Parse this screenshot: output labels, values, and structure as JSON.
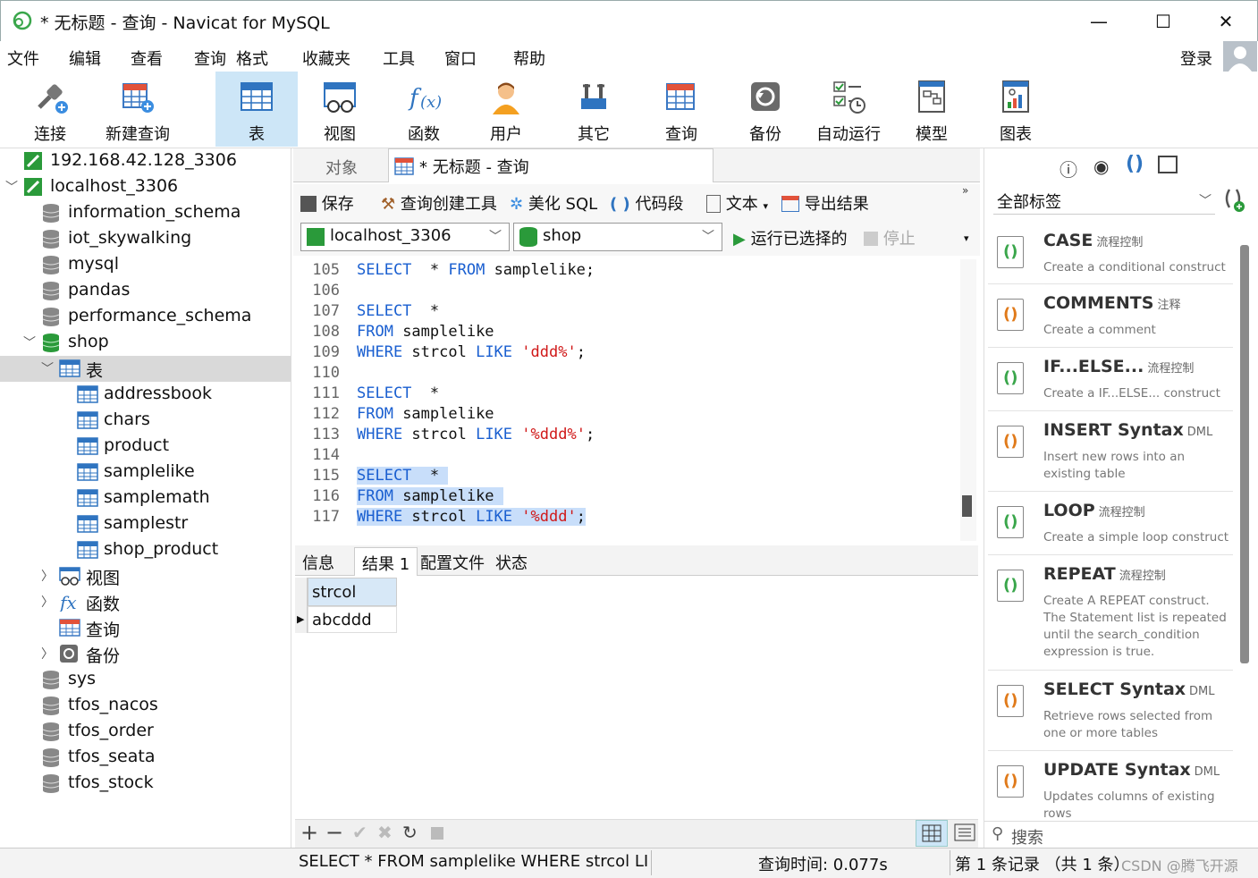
{
  "window": {
    "title": "* 无标题 - 查询 - Navicat for MySQL",
    "minimize": "—",
    "maximize": "☐",
    "close": "✕"
  },
  "menu": [
    "文件",
    "编辑",
    "查看",
    "查询",
    "格式",
    "收藏夹",
    "工具",
    "窗口",
    "帮助"
  ],
  "login": "登录",
  "toolbar": [
    {
      "label": "连接",
      "icon": "plug-icon"
    },
    {
      "label": "新建查询",
      "icon": "new-query-icon"
    },
    {
      "label": "表",
      "icon": "table-icon"
    },
    {
      "label": "视图",
      "icon": "view-icon"
    },
    {
      "label": "函数",
      "icon": "function-icon"
    },
    {
      "label": "用户",
      "icon": "user-icon"
    },
    {
      "label": "其它",
      "icon": "tools-icon"
    },
    {
      "label": "查询",
      "icon": "query-icon"
    },
    {
      "label": "备份",
      "icon": "backup-icon"
    },
    {
      "label": "自动运行",
      "icon": "schedule-icon"
    },
    {
      "label": "模型",
      "icon": "model-icon"
    },
    {
      "label": "图表",
      "icon": "chart-icon"
    }
  ],
  "tree": [
    {
      "label": "192.168.42.128_3306"
    },
    {
      "label": "localhost_3306"
    },
    {
      "label": "information_schema"
    },
    {
      "label": "iot_skywalking"
    },
    {
      "label": "mysql"
    },
    {
      "label": "pandas"
    },
    {
      "label": "performance_schema"
    },
    {
      "label": "shop"
    },
    {
      "label": "表"
    },
    {
      "label": "addressbook"
    },
    {
      "label": "chars"
    },
    {
      "label": "product"
    },
    {
      "label": "samplelike"
    },
    {
      "label": "samplemath"
    },
    {
      "label": "samplestr"
    },
    {
      "label": "shop_product"
    },
    {
      "label": "视图"
    },
    {
      "label": "函数"
    },
    {
      "label": "查询"
    },
    {
      "label": "备份"
    },
    {
      "label": "sys"
    },
    {
      "label": "tfos_nacos"
    },
    {
      "label": "tfos_order"
    },
    {
      "label": "tfos_seata"
    },
    {
      "label": "tfos_stock"
    }
  ],
  "tabs": {
    "objects": "对象",
    "query": "* 无标题 - 查询"
  },
  "editor_toolbar": {
    "save": "保存",
    "builder": "查询创建工具",
    "beautify": "美化 SQL",
    "snippet": "代码段",
    "text": "文本",
    "export": "导出结果"
  },
  "selectors": {
    "connection": "localhost_3306",
    "database": "shop",
    "run": "运行已选择的",
    "stop": "停止"
  },
  "code_lines": [
    {
      "n": "105",
      "t": [
        [
          "kw",
          "SELECT"
        ],
        [
          "",
          "  * "
        ],
        [
          "kw",
          "FROM"
        ],
        [
          "",
          " samplelike;"
        ]
      ]
    },
    {
      "n": "106",
      "t": []
    },
    {
      "n": "107",
      "t": [
        [
          "kw",
          "SELECT"
        ],
        [
          "",
          "  *"
        ]
      ]
    },
    {
      "n": "108",
      "t": [
        [
          "kw",
          "FROM"
        ],
        [
          "",
          " samplelike"
        ]
      ]
    },
    {
      "n": "109",
      "t": [
        [
          "kw",
          "WHERE"
        ],
        [
          "",
          " strcol "
        ],
        [
          "kw",
          "LIKE"
        ],
        [
          "",
          " "
        ],
        [
          "str",
          "'ddd%'"
        ],
        [
          "",
          ";"
        ]
      ]
    },
    {
      "n": "110",
      "t": []
    },
    {
      "n": "111",
      "t": [
        [
          "kw",
          "SELECT"
        ],
        [
          "",
          "  *"
        ]
      ]
    },
    {
      "n": "112",
      "t": [
        [
          "kw",
          "FROM"
        ],
        [
          "",
          " samplelike"
        ]
      ]
    },
    {
      "n": "113",
      "t": [
        [
          "kw",
          "WHERE"
        ],
        [
          "",
          " strcol "
        ],
        [
          "kw",
          "LIKE"
        ],
        [
          "",
          " "
        ],
        [
          "str",
          "'%ddd%'"
        ],
        [
          "",
          ";"
        ]
      ]
    },
    {
      "n": "114",
      "t": []
    },
    {
      "n": "115",
      "t": [
        [
          "kw",
          "SELECT"
        ],
        [
          "",
          "  * "
        ]
      ],
      "hl": true
    },
    {
      "n": "116",
      "t": [
        [
          "kw",
          "FROM"
        ],
        [
          "",
          " samplelike "
        ]
      ],
      "hl": true
    },
    {
      "n": "117",
      "t": [
        [
          "kw",
          "WHERE"
        ],
        [
          "",
          " strcol "
        ],
        [
          "kw",
          "LIKE"
        ],
        [
          "",
          " "
        ],
        [
          "str",
          "'%ddd'"
        ],
        [
          "",
          ";"
        ]
      ],
      "hl": true
    }
  ],
  "result_tabs": [
    "信息",
    "结果 1",
    "配置文件",
    "状态"
  ],
  "result": {
    "column": "strcol",
    "rows": [
      "abcddd"
    ]
  },
  "status": {
    "sql": "SELECT * FROM samplelike WHERE strcol LIKE",
    "time": "查询时间: 0.077s",
    "records": "第 1 条记录 （共 1 条）",
    "watermark": "CSDN @腾飞开源"
  },
  "right_panel": {
    "filter": "全部标签",
    "search": "搜索",
    "snippets": [
      {
        "name": "CASE",
        "cat": "流程控制",
        "desc": "Create a conditional construct"
      },
      {
        "name": "COMMENTS",
        "cat": "注释",
        "desc": "Create a comment"
      },
      {
        "name": "IF...ELSE...",
        "cat": "流程控制",
        "desc": "Create a IF...ELSE... construct"
      },
      {
        "name": "INSERT Syntax",
        "cat": "DML",
        "desc": "Insert new rows into an existing table"
      },
      {
        "name": "LOOP",
        "cat": "流程控制",
        "desc": "Create a simple loop construct"
      },
      {
        "name": "REPEAT",
        "cat": "流程控制",
        "desc": "Create A REPEAT construct. The Statement list is repeated until the search_condition expression is true."
      },
      {
        "name": "SELECT Syntax",
        "cat": "DML",
        "desc": "Retrieve rows selected from one or more tables"
      },
      {
        "name": "UPDATE Syntax",
        "cat": "DML",
        "desc": "Updates columns of existing rows"
      }
    ]
  }
}
